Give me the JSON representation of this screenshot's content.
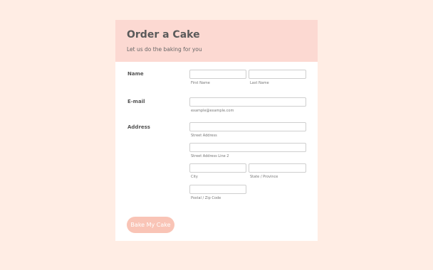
{
  "form": {
    "title": "Order a Cake",
    "subtitle": "Let us do the baking for you"
  },
  "fields": {
    "name": {
      "label": "Name",
      "first_sublabel": "First Name",
      "last_sublabel": "Last Name",
      "first_value": "",
      "last_value": ""
    },
    "email": {
      "label": "E-mail",
      "sublabel": "example@example.com",
      "value": ""
    },
    "address": {
      "label": "Address",
      "street_sublabel": "Street Address",
      "street2_sublabel": "Street Address Line 2",
      "city_sublabel": "City",
      "state_sublabel": "State / Province",
      "postal_sublabel": "Postal / Zip Code"
    }
  },
  "submit": {
    "label": "Bake My Cake"
  },
  "colors": {
    "page_background": "#ffede4",
    "header_background": "#fcd9d2",
    "button_background": "#f9c4b6"
  }
}
